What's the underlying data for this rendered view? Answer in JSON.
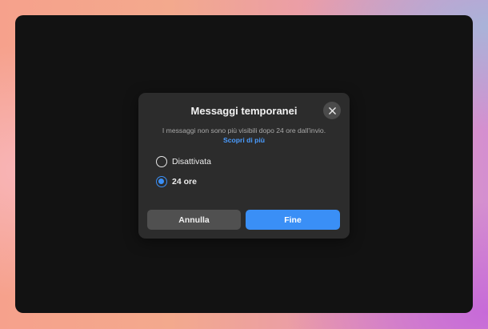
{
  "dialog": {
    "title": "Messaggi temporanei",
    "description": "I messaggi non sono più visibili dopo 24 ore dall'invio.",
    "learn_more": "Scopri di più",
    "options": [
      {
        "label": "Disattivata",
        "selected": false
      },
      {
        "label": "24 ore",
        "selected": true
      }
    ],
    "cancel_label": "Annulla",
    "done_label": "Fine",
    "close_icon": "close-icon"
  },
  "colors": {
    "accent": "#3a8ff6",
    "link": "#4a9cff",
    "dialog_bg": "#2c2c2c",
    "window_bg": "#121212"
  }
}
